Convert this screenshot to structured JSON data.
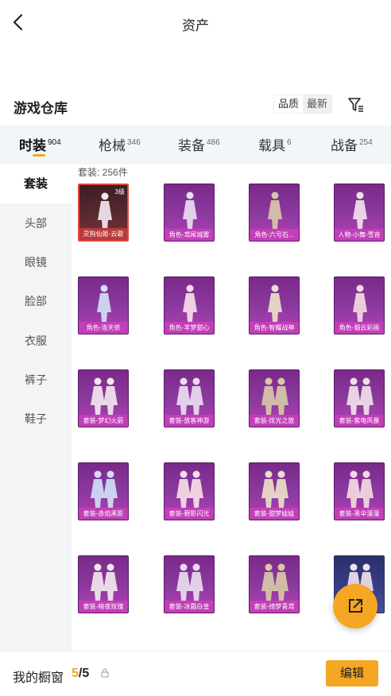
{
  "header": {
    "title": "资产"
  },
  "warehouse": {
    "title": "游戏仓库",
    "sort_options": [
      "品质",
      "最新"
    ],
    "active_sort": 0
  },
  "tabs": [
    {
      "label": "时装",
      "count": "904"
    },
    {
      "label": "枪械",
      "count": "346"
    },
    {
      "label": "装备",
      "count": "486"
    },
    {
      "label": "载具",
      "count": "6"
    },
    {
      "label": "战备",
      "count": "254"
    }
  ],
  "sidebar": {
    "items": [
      "套装",
      "头部",
      "眼镜",
      "脸部",
      "衣服",
      "裤子",
      "鞋子"
    ]
  },
  "content": {
    "count_label": "套装: 256件",
    "items": [
      {
        "name": "灵狗仙姬-云歌",
        "level": "3级",
        "style": "red"
      },
      {
        "name": "角色-鸢尾城雾",
        "style": "purple"
      },
      {
        "name": "角色-六号石...",
        "style": "purple"
      },
      {
        "name": "人物-小舞-雪音",
        "style": "purple"
      },
      {
        "name": "角色-洛天依",
        "style": "purple"
      },
      {
        "name": "角色-羊梦甜心",
        "style": "purple"
      },
      {
        "name": "角色-智耀战神",
        "style": "purple"
      },
      {
        "name": "角色-烟云彩画",
        "style": "purple"
      },
      {
        "name": "套装-梦幻火箭",
        "style": "purple"
      },
      {
        "name": "套装-放客神游",
        "style": "purple"
      },
      {
        "name": "套装-炫光之旅",
        "style": "purple"
      },
      {
        "name": "套装-紫电风暴",
        "style": "purple"
      },
      {
        "name": "套装-赤焰黑影",
        "style": "purple"
      },
      {
        "name": "套装-碧影闪光",
        "style": "purple"
      },
      {
        "name": "套装-甜梦娃娃",
        "style": "purple"
      },
      {
        "name": "套装-黑伞漫漫",
        "style": "purple"
      },
      {
        "name": "套装-暗夜玫瑰",
        "style": "purple"
      },
      {
        "name": "套装-冰霜白皇",
        "style": "purple"
      },
      {
        "name": "套装-绮梦青鸢",
        "style": "purple"
      },
      {
        "name": "",
        "style": "blue"
      }
    ]
  },
  "footer": {
    "showcase_label": "我的橱窗",
    "showcase_current": "5",
    "showcase_total": "/5",
    "edit_label": "编辑"
  },
  "colors": {
    "accent": "#f5a623",
    "card_purple": "#8d3aa0",
    "card_red_border": "#e0473e"
  },
  "icons": {
    "back": "chevron-left-icon",
    "filter": "filter-icon",
    "share": "external-link-icon",
    "lock": "lock-icon"
  }
}
